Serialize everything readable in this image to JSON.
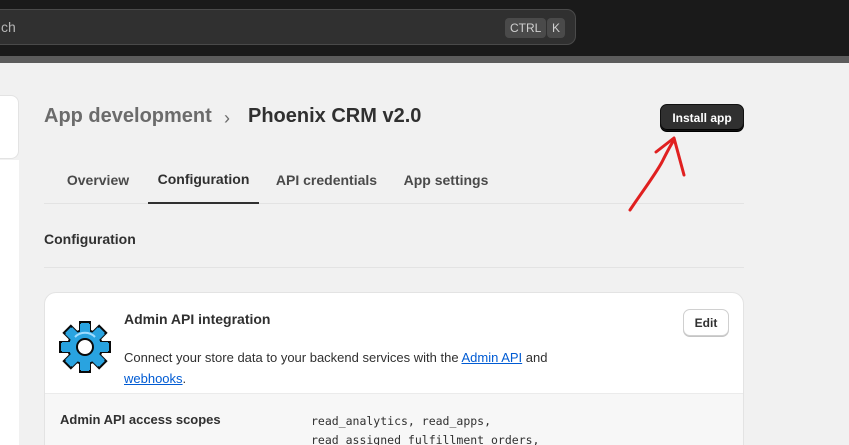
{
  "topbar": {
    "search_placeholder": "ch",
    "kbd_ctrl": "CTRL",
    "kbd_k": "K"
  },
  "header": {
    "breadcrumb_parent": "App development",
    "breadcrumb_separator": "›",
    "title": "Phoenix CRM v2.0",
    "install_button": "Install app"
  },
  "tabs": [
    {
      "label": "Overview",
      "active": false
    },
    {
      "label": "Configuration",
      "active": true
    },
    {
      "label": "API credentials",
      "active": false
    },
    {
      "label": "App settings",
      "active": false
    }
  ],
  "section_title": "Configuration",
  "card": {
    "icon": "gear-icon",
    "title": "Admin API integration",
    "desc_prefix": "Connect your store data to your backend services with the ",
    "admin_api_link": "Admin API",
    "desc_mid": " and",
    "webhooks_link": "webhooks",
    "desc_suffix": ".",
    "edit_button": "Edit",
    "scopes_label": "Admin API access scopes",
    "scopes_line1": "read_analytics, read_apps,",
    "scopes_line2": "read_assigned_fulfillment_orders,"
  },
  "colors": {
    "accent_dark": "#303030",
    "link": "#005bd3",
    "annotation_arrow": "#e02020",
    "gear_fill": "#29a3e0"
  }
}
